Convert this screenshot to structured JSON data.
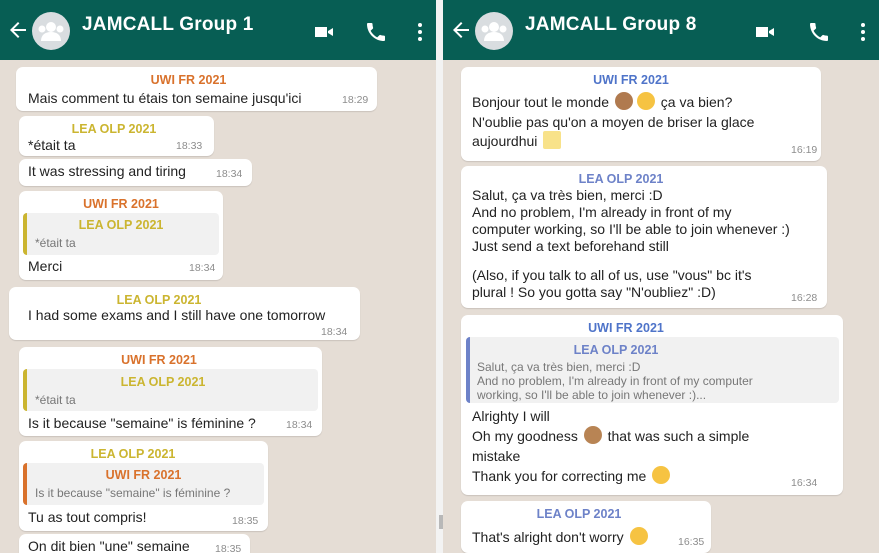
{
  "left": {
    "title": "JAMCALL Group 1",
    "messages": {
      "m1": {
        "sender": "UWI FR 2021",
        "text": "Mais comment tu étais ton semaine jusqu'ici",
        "time": "18:29"
      },
      "m2": {
        "sender": "LEA OLP 2021",
        "text": "*était ta",
        "time": "18:33"
      },
      "m3": {
        "text": "It was stressing and tiring",
        "time": "18:34"
      },
      "m4": {
        "sender": "UWI FR 2021",
        "quote_sender": "LEA OLP 2021",
        "quote_text": "*était ta",
        "text": "Merci",
        "time": "18:34"
      },
      "m5": {
        "sender": "LEA OLP 2021",
        "text": "I had some exams and I still have one tomorrow",
        "time": "18:34"
      },
      "m6": {
        "sender": "UWI FR 2021",
        "quote_sender": "LEA OLP 2021",
        "quote_text": "*était ta",
        "text": "Is it because \"semaine\" is féminine ?",
        "time": "18:34"
      },
      "m7": {
        "sender": "LEA OLP 2021",
        "quote_sender": "UWI FR 2021",
        "quote_text": "Is it because \"semaine\" is féminine ?",
        "text": "Tu as tout compris!",
        "time": "18:35"
      },
      "m8": {
        "text": "On dit bien \"une\" semaine",
        "time": "18:35"
      }
    }
  },
  "right": {
    "title": "JAMCALL Group 8",
    "messages": {
      "m1": {
        "sender": "UWI FR 2021",
        "line1": "Bonjour tout le monde",
        "line1b": "ça va bien?",
        "line2": "N'oublie pas qu'on a moyen de briser la glace",
        "line3": "aujourdhui",
        "time": "16:19"
      },
      "m2": {
        "sender": "LEA OLP 2021",
        "line1": "Salut, ça va très bien, merci :D",
        "line2": "And no problem, I'm already in front of my",
        "line3": "computer working, so I'll be able to join whenever :)",
        "line4": "Just send a text beforehand still",
        "line5": "(Also, if you talk to all of us, use \"vous\" bc it's",
        "line6": "plural ! So you gotta say \"N'oubliez\" :D)",
        "time": "16:28"
      },
      "m3": {
        "sender": "UWI FR 2021",
        "quote_sender": "LEA OLP 2021",
        "quote1": "Salut, ça va très bien, merci :D",
        "quote2": "And no problem, I'm already in front of my computer",
        "quote3": "working, so I'll be able to join whenever :)...",
        "line1": "Alrighty I will",
        "line2": "Oh my goodness",
        "line2b": "that was such a simple",
        "line3": "mistake",
        "line4": "Thank you for correcting me",
        "time": "16:34"
      },
      "m4": {
        "sender": "LEA OLP 2021",
        "text": "That's alright don't worry",
        "time": "16:35"
      }
    }
  },
  "icons": [
    "back-arrow-icon",
    "group-avatar-icon",
    "video-call-icon",
    "voice-call-icon",
    "more-options-icon"
  ],
  "colors": {
    "header": "#075e54",
    "background": "#e5ddd5",
    "bubble": "#ffffff",
    "uwi": "#d9722c",
    "lea": "#cbb530",
    "lea_right": "#6d82c8",
    "uwi_right": "#4f74c9"
  }
}
